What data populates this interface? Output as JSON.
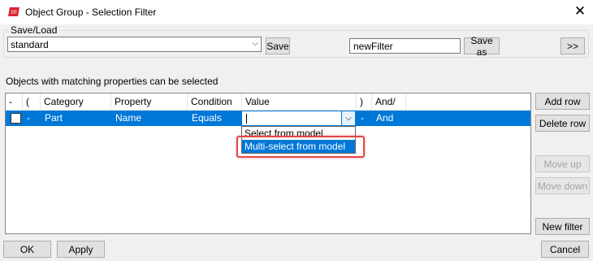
{
  "window": {
    "title": "Object Group - Selection Filter",
    "close_glyph": "✕"
  },
  "save_load": {
    "group_label": "Save/Load",
    "filter_combo_value": "standard",
    "combo_arrow": "⌵",
    "save_button": "Save",
    "filter_name_value": "newFilter",
    "save_as_button": "Save as",
    "expand_button": ">>"
  },
  "hint": "Objects with matching properties can be selected",
  "table": {
    "headers": [
      "-",
      "(",
      "Category",
      "Property",
      "Condition",
      "Value",
      ")",
      "And/"
    ],
    "row": {
      "checked": false,
      "dash": "-",
      "open_paren": "",
      "category": "Part",
      "property": "Name",
      "condition": "Equals",
      "value": "",
      "close_paren": "-",
      "and_or": "And"
    }
  },
  "value_dropdown": {
    "arrow": "⌵",
    "options": [
      "Select from model",
      "Multi-select from model"
    ],
    "selected_index": 1
  },
  "side_buttons": {
    "add_row": "Add row",
    "delete_row": "Delete row",
    "move_up": "Move up",
    "move_down": "Move down",
    "new_filter": "New filter"
  },
  "footer": {
    "ok": "OK",
    "apply": "Apply",
    "cancel": "Cancel"
  },
  "colors": {
    "selection": "#0078d7",
    "highlight_box": "#e6464b",
    "app_icon": "#d9232e"
  },
  "icons": {
    "app": "app-logo-icon",
    "close": "close-icon",
    "dropdown": "chevron-down-icon",
    "checkbox": "checkbox-icon"
  }
}
